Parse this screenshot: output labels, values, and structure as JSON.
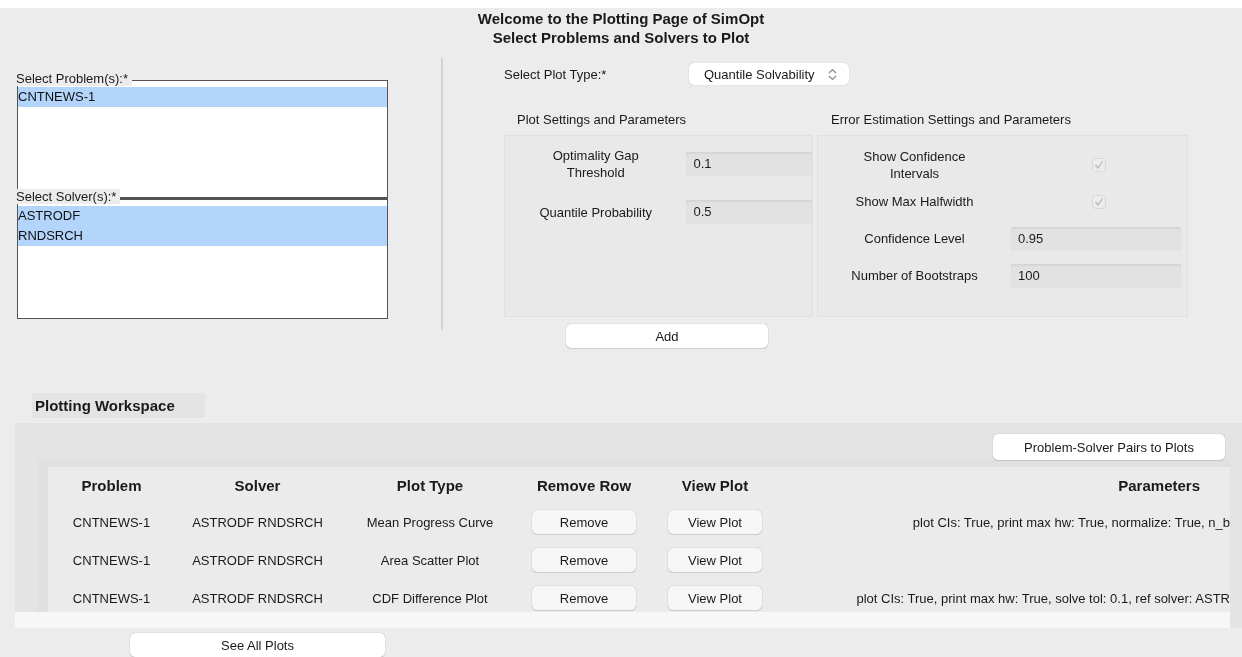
{
  "title": [
    "Welcome to the Plotting Page of SimOpt",
    "Select Problems and Solvers to Plot"
  ],
  "problems": {
    "label": "Select Problem(s):*",
    "items": [
      {
        "label": "CNTNEWS-1",
        "selected": true
      }
    ]
  },
  "solvers": {
    "label": "Select Solver(s):*",
    "items": [
      {
        "label": "ASTRODF",
        "selected": true
      },
      {
        "label": "RNDSRCH",
        "selected": true
      }
    ]
  },
  "plot_type": {
    "label": "Select Plot Type:*",
    "value": "Quantile Solvability"
  },
  "plot_settings": {
    "heading": "Plot Settings and Parameters",
    "fields": [
      {
        "label": "Optimality Gap Threshold",
        "value": "0.1"
      },
      {
        "label": "Quantile Probability",
        "value": "0.5"
      }
    ]
  },
  "error_settings": {
    "heading": "Error Estimation Settings and Parameters",
    "fields": [
      {
        "kind": "checkbox",
        "label": "Show Confidence Intervals",
        "checked": true
      },
      {
        "kind": "checkbox",
        "label": "Show Max Halfwidth",
        "checked": true
      },
      {
        "kind": "text",
        "label": "Confidence Level",
        "value": "0.95"
      },
      {
        "kind": "text",
        "label": "Number of Bootstraps",
        "value": "100"
      }
    ]
  },
  "add_button": "Add",
  "workspace": {
    "title": "Plotting Workspace",
    "pairs_button": "Problem-Solver Pairs to Plots",
    "columns": [
      "Problem",
      "Solver",
      "Plot Type",
      "Remove Row",
      "View Plot",
      "Parameters"
    ],
    "rows": [
      {
        "problem": "CNTNEWS-1",
        "solver": "ASTRODF RNDSRCH",
        "plot_type": "Mean Progress Curve",
        "remove": "Remove",
        "view": "View Plot",
        "parameters": "plot CIs: True, print max hw: True, normalize: True, n_b"
      },
      {
        "problem": "CNTNEWS-1",
        "solver": "ASTRODF RNDSRCH",
        "plot_type": "Area Scatter Plot",
        "remove": "Remove",
        "view": "View Plot"
      },
      {
        "problem": "CNTNEWS-1",
        "solver": "ASTRODF RNDSRCH",
        "plot_type": "CDF Difference Plot",
        "remove": "Remove",
        "view": "View Plot",
        "parameters": "plot CIs: True, print max hw: True, solve tol: 0.1, ref solver: ASTR"
      }
    ],
    "see_all_button": "See All Plots"
  }
}
